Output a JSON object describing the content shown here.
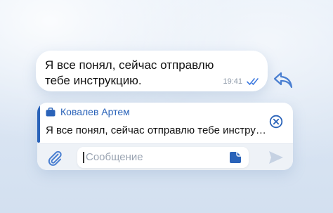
{
  "message": {
    "text": "Я все понял, сейчас отправлю тебе инструкцию.",
    "time": "19:41"
  },
  "reply": {
    "author": "Ковалев Артем",
    "preview": "Я все понял, сейчас отправлю тебе инстру…"
  },
  "composer": {
    "placeholder": "Сообщение"
  },
  "colors": {
    "accent": "#2a63b9",
    "read_check": "#3f7be0",
    "icon_blue": "#4a7fd1",
    "send_disabled": "#c6d2e3"
  },
  "icons": [
    "double-check-icon",
    "reply-arrow-icon",
    "briefcase-icon",
    "cancel-icon",
    "paperclip-icon",
    "sticker-icon",
    "send-icon"
  ]
}
